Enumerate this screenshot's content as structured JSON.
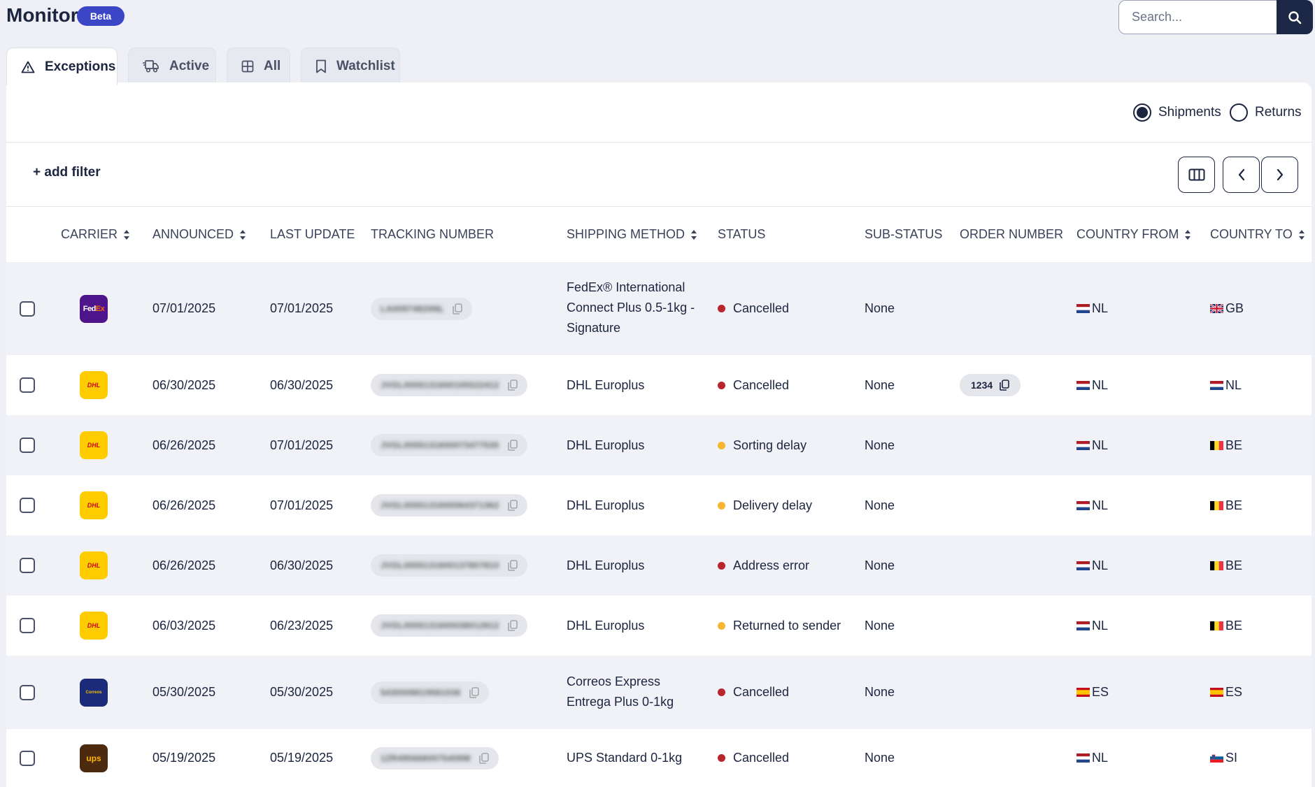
{
  "header": {
    "title": "Monitor",
    "badge": "Beta"
  },
  "search": {
    "placeholder": "Search..."
  },
  "tabs": [
    {
      "label": "Exceptions",
      "icon": "warning-triangle-icon",
      "active": true
    },
    {
      "label": "Active",
      "icon": "truck-icon",
      "active": false
    },
    {
      "label": "All",
      "icon": "grid-icon",
      "active": false
    },
    {
      "label": "Watchlist",
      "icon": "bookmark-icon",
      "active": false
    }
  ],
  "toggle": {
    "shipments": "Shipments",
    "returns": "Returns",
    "selected": "Shipments"
  },
  "filter": {
    "add_filter": "+ add filter"
  },
  "columns": {
    "carrier": "CARRIER",
    "announced": "ANNOUNCED",
    "last_update": "LAST UPDATE",
    "tracking": "TRACKING NUMBER",
    "shipping": "SHIPPING METHOD",
    "status": "STATUS",
    "sub_status": "SUB-STATUS",
    "order": "ORDER NUMBER",
    "country_from": "COUNTRY FROM",
    "country_to": "COUNTRY TO"
  },
  "status_colors": {
    "red": "#b8262b",
    "amber": "#f5b731"
  },
  "rows": [
    {
      "carrier": "FedEx",
      "announced": "07/01/2025",
      "last_update": "07/01/2025",
      "tracking": "LA00974820NL",
      "shipping_1": "FedEx® International",
      "shipping_2": "Connect Plus 0.5-1kg -",
      "shipping_3": "Signature",
      "status": "Cancelled",
      "status_color": "#b8262b",
      "sub_status": "None",
      "order": "",
      "from": "NL",
      "to": "GB"
    },
    {
      "carrier": "DHL",
      "announced": "06/30/2025",
      "last_update": "06/30/2025",
      "tracking": "JVGL0055131600105522412",
      "shipping_1": "DHL Europlus",
      "status": "Cancelled",
      "status_color": "#b8262b",
      "sub_status": "None",
      "order": "1234",
      "from": "NL",
      "to": "NL"
    },
    {
      "carrier": "DHL",
      "announced": "06/26/2025",
      "last_update": "07/01/2025",
      "tracking": "JVGL0055131600073477530",
      "shipping_1": "DHL Europlus",
      "status": "Sorting delay",
      "status_color": "#f5b731",
      "sub_status": "None",
      "order": "",
      "from": "NL",
      "to": "BE"
    },
    {
      "carrier": "DHL",
      "announced": "06/26/2025",
      "last_update": "07/01/2025",
      "tracking": "JVGL0055131600064371362",
      "shipping_1": "DHL Europlus",
      "status": "Delivery delay",
      "status_color": "#f5b731",
      "sub_status": "None",
      "order": "",
      "from": "NL",
      "to": "BE"
    },
    {
      "carrier": "DHL",
      "announced": "06/26/2025",
      "last_update": "06/30/2025",
      "tracking": "JVGL0055131600137807810",
      "shipping_1": "DHL Europlus",
      "status": "Address error",
      "status_color": "#b8262b",
      "sub_status": "None",
      "order": "",
      "from": "NL",
      "to": "BE"
    },
    {
      "carrier": "DHL",
      "announced": "06/03/2025",
      "last_update": "06/23/2025",
      "tracking": "JVGL0055131600038012812",
      "shipping_1": "DHL Europlus",
      "status": "Returned to sender",
      "status_color": "#f5b731",
      "sub_status": "None",
      "order": "",
      "from": "NL",
      "to": "BE"
    },
    {
      "carrier": "Correos Express",
      "announced": "05/30/2025",
      "last_update": "05/30/2025",
      "tracking": "5430008619581036",
      "shipping_1": "Correos Express",
      "shipping_2": "Entrega Plus 0-1kg",
      "status": "Cancelled",
      "status_color": "#b8262b",
      "sub_status": "None",
      "order": "",
      "from": "ES",
      "to": "ES"
    },
    {
      "carrier": "UPS",
      "announced": "05/19/2025",
      "last_update": "05/19/2025",
      "tracking": "1ZR4956680075409W",
      "shipping_1": "UPS Standard 0-1kg",
      "status": "Cancelled",
      "status_color": "#b8262b",
      "sub_status": "None",
      "order": "",
      "from": "NL",
      "to": "SI"
    }
  ]
}
